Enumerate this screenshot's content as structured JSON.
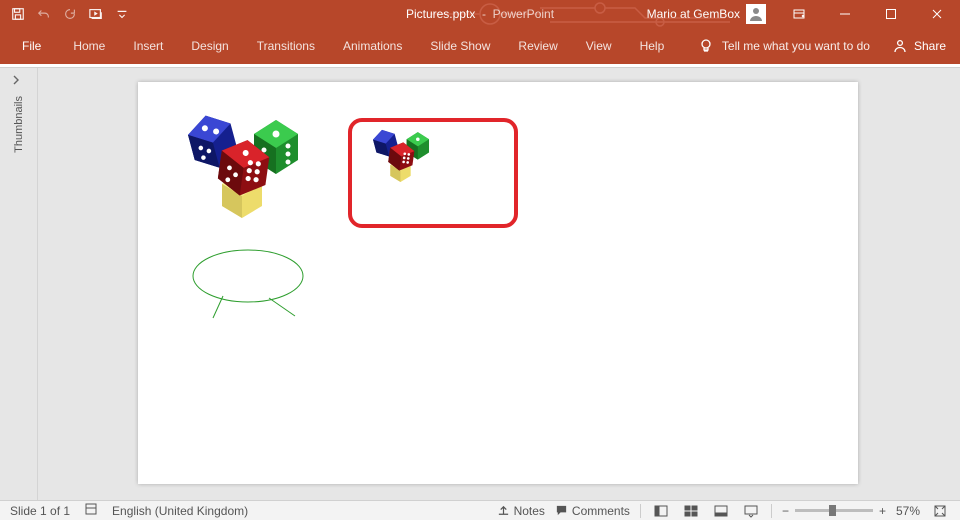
{
  "title": {
    "doc": "Pictures.pptx",
    "sep": "-",
    "app": "PowerPoint"
  },
  "user": {
    "name": "Mario at GemBox"
  },
  "qat": {
    "save": "save-icon",
    "undo": "undo-icon",
    "redo": "redo-icon",
    "start": "start-from-beginning-icon",
    "customize": "customize-qat-icon"
  },
  "ribbon": {
    "file": "File",
    "tabs": [
      "Home",
      "Insert",
      "Design",
      "Transitions",
      "Animations",
      "Slide Show",
      "Review",
      "View",
      "Help"
    ],
    "tellme_placeholder": "Tell me what you want to do",
    "share": "Share"
  },
  "thumbnails": {
    "label": "Thumbnails"
  },
  "slide": {
    "images": {
      "dice_large": "dice-cluster",
      "dice_small": "dice-cluster"
    },
    "shapes": {
      "red_rect": {
        "stroke": "#E1252A"
      },
      "speech_bubble": {
        "stroke": "#2E8B2E"
      }
    }
  },
  "status": {
    "slide_indicator": "Slide 1 of 1",
    "language": "English (United Kingdom)",
    "notes": "Notes",
    "comments": "Comments",
    "zoom_pct": "57%"
  }
}
